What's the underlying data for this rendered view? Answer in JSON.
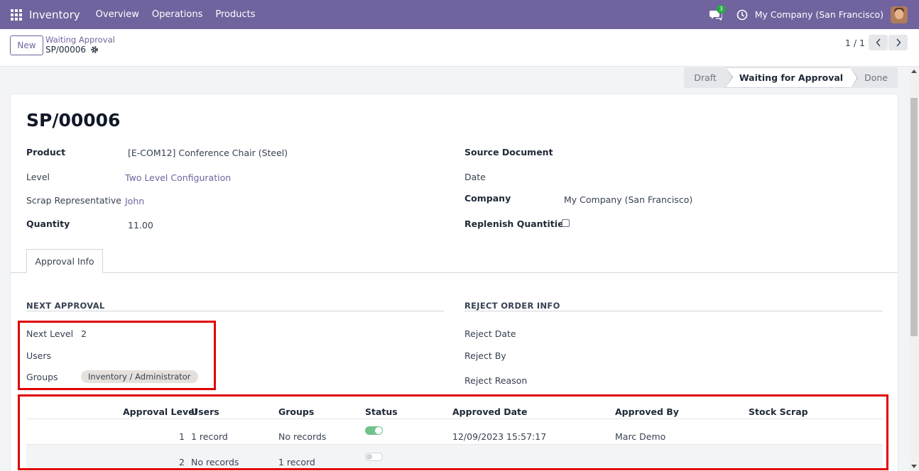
{
  "navbar": {
    "brand": "Inventory",
    "menu": [
      "Overview",
      "Operations",
      "Products"
    ],
    "messages_badge": "3",
    "company": "My Company (San Francisco)"
  },
  "control_panel": {
    "new_label": "New",
    "breadcrumb_parent": "Waiting Approval",
    "breadcrumb_current": "SP/00006",
    "pager": "1 / 1"
  },
  "statusbar": {
    "stages": [
      "Draft",
      "Waiting for Approval",
      "Done"
    ],
    "active": "Waiting for Approval"
  },
  "form": {
    "title": "SP/00006",
    "left": {
      "product_label": "Product",
      "product_value": "[E-COM12] Conference Chair (Steel)",
      "level_label": "Level",
      "level_value": "Two Level Configuration",
      "rep_label": "Scrap Representative",
      "rep_value": "John",
      "qty_label": "Quantity",
      "qty_value": "11.00"
    },
    "right": {
      "source_label": "Source Document",
      "date_label": "Date",
      "company_label": "Company",
      "company_value": "My Company (San Francisco)",
      "replenish_label": "Replenish Quantities"
    },
    "tab_label": "Approval Info",
    "next_approval": {
      "title": "NEXT APPROVAL",
      "next_level_label": "Next Level",
      "next_level_value": "2",
      "users_label": "Users",
      "groups_label": "Groups",
      "groups_tag": "Inventory / Administrator"
    },
    "reject_info": {
      "title": "REJECT ORDER INFO",
      "date_label": "Reject Date",
      "by_label": "Reject By",
      "reason_label": "Reject Reason"
    },
    "table": {
      "headers": [
        "Approval Level",
        "Users",
        "Groups",
        "Status",
        "Approved Date",
        "Approved By",
        "Stock Scrap"
      ],
      "rows": [
        {
          "level": "1",
          "users": "1 record",
          "groups": "No records",
          "status_on": true,
          "date": "12/09/2023 15:57:17",
          "by": "Marc Demo",
          "scrap": ""
        },
        {
          "level": "2",
          "users": "No records",
          "groups": "1 record",
          "status_on": false,
          "date": "",
          "by": "",
          "scrap": ""
        }
      ]
    }
  },
  "colors": {
    "brand": "#71639e",
    "highlight_box": "#e00000",
    "toggle_on": "#6fc48a"
  }
}
